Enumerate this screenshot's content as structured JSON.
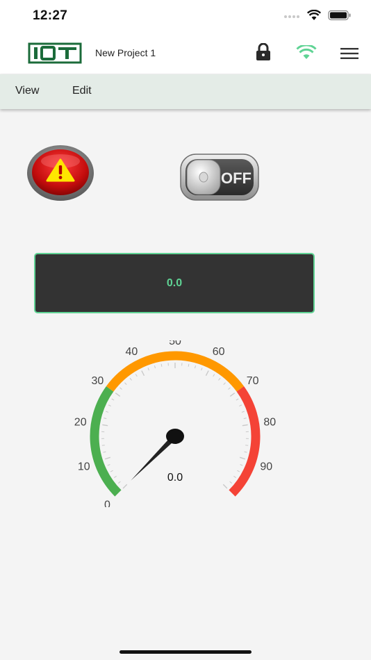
{
  "status_bar": {
    "time": "12:27",
    "icons": [
      "cellular-signal-icon",
      "wifi-icon",
      "battery-icon"
    ]
  },
  "header": {
    "logo_text": "IOT",
    "project_name": "New Project 1",
    "icons": [
      "lock-icon",
      "wifi-icon",
      "hamburger-menu-icon"
    ],
    "accent_color": "#5fd394",
    "logo_color": "#1b6b3a"
  },
  "menu": {
    "items": [
      "View",
      "Edit"
    ]
  },
  "widgets": {
    "alarm": {
      "icon": "warning-icon",
      "color": "#d11b1b"
    },
    "switch": {
      "state_label": "OFF"
    },
    "display": {
      "value": "0.0"
    },
    "gauge": {
      "min": 0,
      "max": 100,
      "value": 0.0,
      "value_label": "0.0",
      "tick_labels": [
        "0",
        "10",
        "20",
        "30",
        "40",
        "50",
        "60",
        "70",
        "80",
        "90"
      ],
      "zones": [
        {
          "from": 0,
          "to": 30,
          "color": "#4caf50"
        },
        {
          "from": 30,
          "to": 70,
          "color": "#ff9800"
        },
        {
          "from": 70,
          "to": 100,
          "color": "#f44336"
        }
      ]
    }
  }
}
